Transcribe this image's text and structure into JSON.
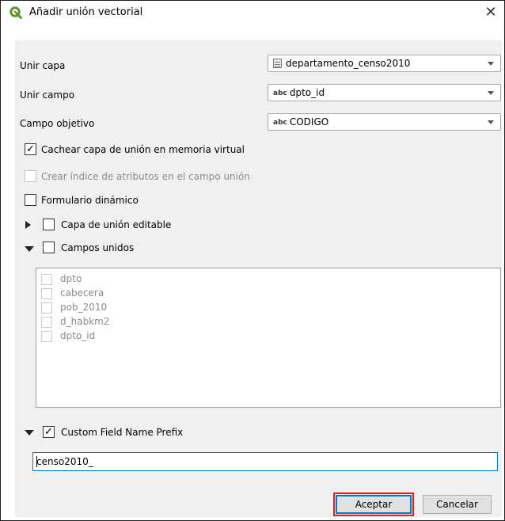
{
  "window": {
    "title": "Añadir unión vectorial",
    "close": "✕",
    "logo_color": "#589632"
  },
  "form": {
    "join_layer": {
      "label": "Unir capa",
      "value": "departamento_censo2010",
      "icon": "vector-table-icon"
    },
    "join_field": {
      "label": "Unir campo",
      "value": "dpto_id",
      "type_badge": "abc"
    },
    "target_field": {
      "label": "Campo objetivo",
      "value": "CODIGO",
      "type_badge": "abc"
    }
  },
  "options": {
    "cache": {
      "label": "Cachear capa de unión en memoria virtual",
      "checked": true
    },
    "index": {
      "label": "Crear índice de atributos en el campo unión",
      "checked": false,
      "enabled": false
    },
    "dynamic": {
      "label": "Formulario dinámico",
      "checked": false
    },
    "editable": {
      "label": "Capa de unión editable",
      "checked": false,
      "expanded": false
    },
    "joined_fields": {
      "label": "Campos unidos",
      "checked": false,
      "expanded": true
    },
    "prefix": {
      "label": "Custom Field Name Prefix",
      "checked": true,
      "expanded": true
    }
  },
  "joined_fields_list": [
    "dpto",
    "cabecera",
    "pob_2010",
    "d_habkm2",
    "dpto_id"
  ],
  "prefix_value": "censo2010_",
  "buttons": {
    "ok": "Aceptar",
    "cancel": "Cancelar"
  },
  "colors": {
    "highlight": "#e0201b",
    "focus": "#0078d7"
  }
}
